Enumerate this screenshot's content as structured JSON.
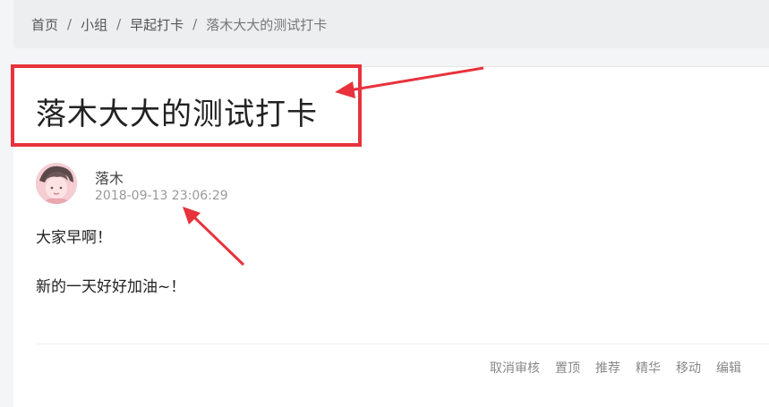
{
  "breadcrumb": {
    "items": [
      "首页",
      "小组",
      "早起打卡"
    ],
    "separator": "/",
    "current": "落木大大的测试打卡"
  },
  "post": {
    "title": "落木大大的测试打卡",
    "author": "落木",
    "time": "2018-09-13 23:06:29",
    "paragraphs": [
      "大家早啊！",
      "新的一天好好加油~！"
    ]
  },
  "actions": [
    "取消审核",
    "置顶",
    "推荐",
    "精华",
    "移动",
    "编辑"
  ],
  "colors": {
    "annotation_red": "#e8323c",
    "breadcrumb_bg": "#eceeef",
    "muted_text": "#999999"
  }
}
